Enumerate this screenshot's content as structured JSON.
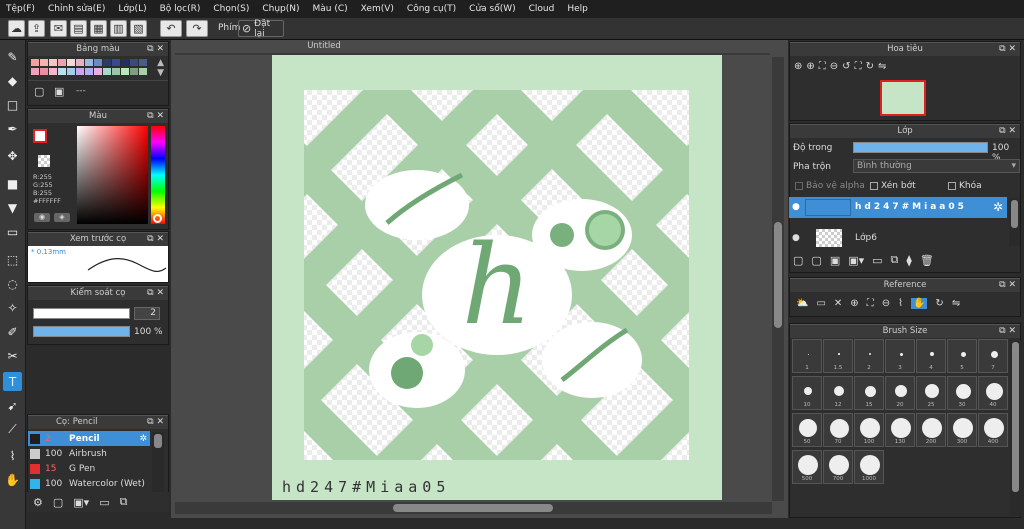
{
  "menu": [
    "Tệp(F)",
    "Chỉnh sửa(E)",
    "Lớp(L)",
    "Bộ lọc(R)",
    "Chọn(S)",
    "Chụp(N)",
    "Màu (C)",
    "Xem(V)",
    "Công cụ(T)",
    "Cửa sổ(W)",
    "Cloud",
    "Help"
  ],
  "toolbar": {
    "key_label": "Phím",
    "reset_label": "Đặt lại"
  },
  "panels": {
    "palette_title": "Bảng màu",
    "color_title": "Màu",
    "color_r": "R:255",
    "color_g": "G:255",
    "color_b": "B:255",
    "color_hex": "#FFFFFF",
    "preview_title": "Xem trước cọ",
    "preview_size": "0.13mm",
    "brush_ctrl_title": "Kiểm soát cọ",
    "brush_size_val": "2",
    "brush_opacity_val": "100 %",
    "brush_list_title": "Cọ: Pencil",
    "palette_dots": "---"
  },
  "brushes": [
    {
      "size": "2",
      "name": "Pencil",
      "color": "#1f1f1f"
    },
    {
      "size": "100",
      "name": "Airbrush",
      "color": "#cccccc"
    },
    {
      "size": "15",
      "name": "G Pen",
      "color": "#e03030"
    },
    {
      "size": "100",
      "name": "Watercolor (Wet)",
      "color": "#33b4e8"
    }
  ],
  "canvas": {
    "tab": "Untitled",
    "signature": "hd247#Miaa05",
    "letter": "h"
  },
  "navigator": {
    "title": "Hoa tiêu"
  },
  "layers": {
    "title": "Lớp",
    "opacity_label": "Độ trong",
    "opacity_val": "100 %",
    "blend_label": "Pha trộn",
    "blend_val": "Bình thường",
    "alpha_label": "Bảo vệ alpha",
    "clip_label": "Xén bớt",
    "lock_label": "Khóa",
    "items": [
      {
        "name": "hd247#Miaa05"
      },
      {
        "name": "Lớp6"
      }
    ]
  },
  "reference": {
    "title": "Reference"
  },
  "brushsize": {
    "title": "Brush Size",
    "sizes": [
      "1",
      "1.5",
      "2",
      "3",
      "4",
      "5",
      "7",
      "10",
      "12",
      "15",
      "20",
      "25",
      "30",
      "40",
      "50",
      "70",
      "100",
      "130",
      "200",
      "300",
      "400",
      "500",
      "700",
      "1000"
    ]
  },
  "colors": {
    "accent": "#2f8fd8",
    "canvas_bg": "#c6e4c6",
    "green": "#7ab07e"
  }
}
